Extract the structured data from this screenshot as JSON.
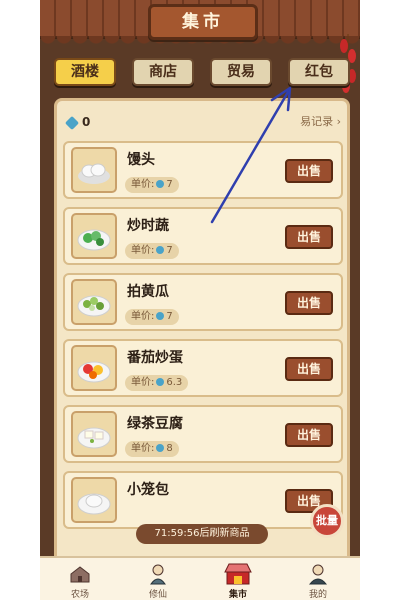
{
  "header": {
    "title": "集市"
  },
  "tabs": [
    {
      "label": "酒楼",
      "active": true
    },
    {
      "label": "商店",
      "active": false
    },
    {
      "label": "贸易",
      "active": false
    },
    {
      "label": "红包",
      "active": false
    }
  ],
  "wallet": {
    "count": "0"
  },
  "trade_link": "易记录 ›",
  "price_label": "单价:",
  "sell_label": "出售",
  "items": [
    {
      "name": "馒头",
      "price": "7"
    },
    {
      "name": "炒时蔬",
      "price": "7"
    },
    {
      "name": "拍黄瓜",
      "price": "7"
    },
    {
      "name": "番茄炒蛋",
      "price": "6.3"
    },
    {
      "name": "绿茶豆腐",
      "price": "8"
    },
    {
      "name": "小笼包",
      "price": ""
    }
  ],
  "refresh_text": "71:59:56后刷新商品",
  "batch_label": "批量",
  "nav": [
    {
      "label": "农场",
      "icon": "farm-icon",
      "active": false
    },
    {
      "label": "修仙",
      "icon": "cultivate-icon",
      "active": false
    },
    {
      "label": "集市",
      "icon": "market-icon",
      "active": true
    },
    {
      "label": "我的",
      "icon": "profile-icon",
      "active": false
    }
  ],
  "colors": {
    "frame": "#5a3a26",
    "panel": "#f4e6c6",
    "active_tab": "#f5cf4a",
    "sell_button": "#9a4e2e",
    "annotation_arrow": "#2f3fae"
  }
}
